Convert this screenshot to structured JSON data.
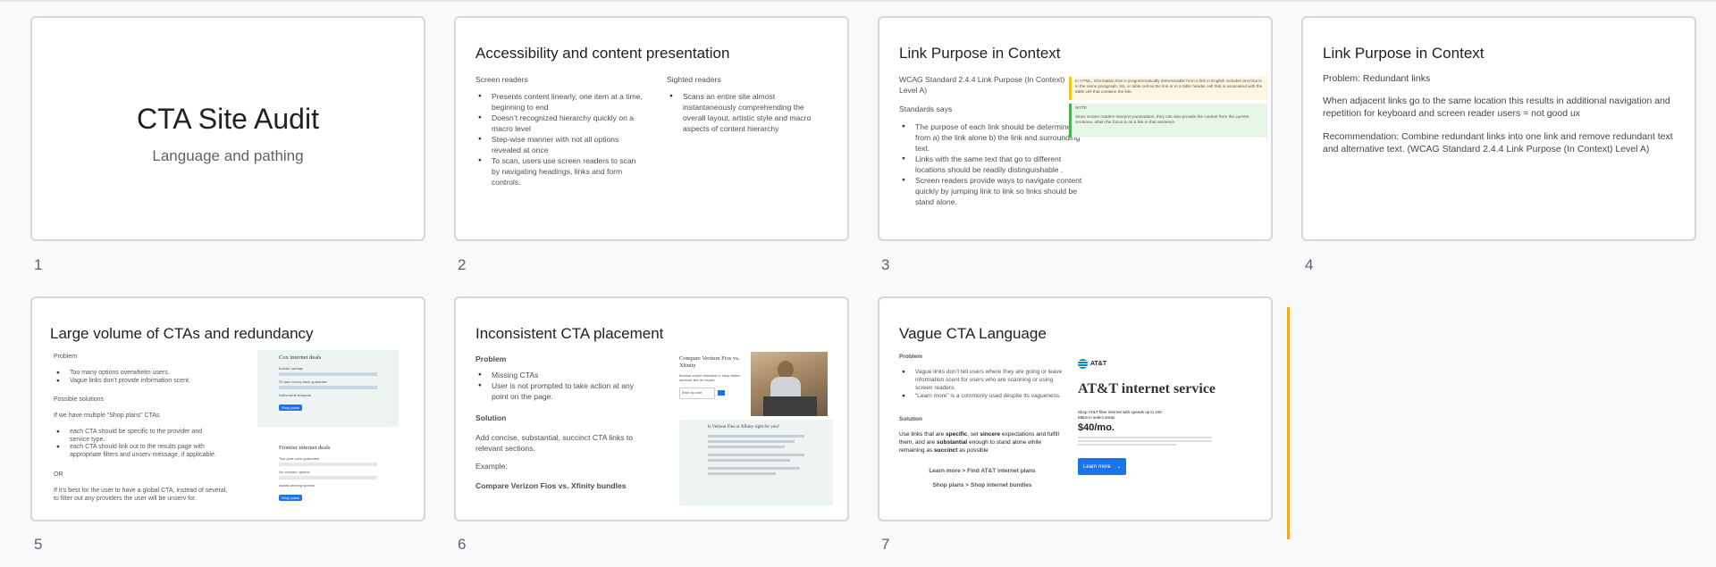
{
  "slides": [
    {
      "number": "1",
      "title": "CTA Site Audit",
      "subtitle": "Language and pathing"
    },
    {
      "number": "2",
      "title": "Accessibility and content presentation",
      "left_heading": "Screen readers",
      "left_bullets": [
        "Presents content linearly, one item at a time, beginning to end",
        "Doesn’t recognized hierarchy quickly on a macro level",
        "Step-wise manner with not all options revealed at once",
        "To scan, users use screen readers to scan by navigating headings, links and form controls."
      ],
      "right_heading": "Sighted readers",
      "right_bullets": [
        "Scans an entire site almost instantaneously comprehending the overall layout, artistic style and macro aspects of content hierarchy"
      ]
    },
    {
      "number": "3",
      "title": "Link Purpose in Context",
      "standard": "WCAG Standard 2.4.4 Link Purpose (In Context) Level A)",
      "standards_says": "Standards says",
      "bullets": [
        "The purpose of each link should  be determined from a) the link alone b) the link and surrounding text.",
        "Links with the same text that go to different locations should be readily distinguishable .",
        "Screen readers provide ways to navigate content quickly by jumping link to link so links should be stand alone."
      ],
      "quote_text": "In HTML, information that is programmatically determinable from a link in English includes text that is in the same paragraph, list, or table cell as the link or in a table header cell that is associated with the table cell that contains the link.",
      "note_label": "NOTE",
      "note_text": "Since screen readers interpret punctuation, they can also provide the context from the current sentence, when the focus is on a link in that sentence."
    },
    {
      "number": "4",
      "title": "Link Purpose in Context",
      "problem": "Problem: Redundant links",
      "para1": "When adjacent links go to the same location this results in additional navigation and repetition for keyboard and screen reader users = not good ux",
      "para2": "Recommendation: Combine redundant links into one link and remove redundant text and alternative text. (WCAG Standard 2.4.4 Link Purpose (In Context) Level A)"
    },
    {
      "number": "5",
      "title": "Large volume of CTAs and redundancy",
      "problem": "Problem",
      "bullets1": [
        "Too many options overwhelm users.",
        "Vague links don’t provide information scent."
      ],
      "possible": "Possible solutions",
      "if_multiple": "If we have multiple “Shop plans” CTAs",
      "bullets2": [
        "each CTA should be specific to the provider and service type.",
        "each CTA should link out to the results page with appropriate filters and unserv message, if applicable."
      ],
      "or": "OR",
      "last": "If it’s best for the user to have a global CTA, instead of several, to filter out any providers the user will be unserv for.",
      "panel1_title": "Cox internet deals",
      "panel1_lines": [
        "Bundle savings",
        "30-day money-back guarantee",
        "Nationwide hotspots"
      ],
      "panel1_button": "Shop plans",
      "panel2_title": "Frontier internet deals",
      "panel2_lines": [
        "Two-year price guarantee",
        "No contract options",
        "Award-winning speeds"
      ],
      "panel2_button": "Shop plans"
    },
    {
      "number": "6",
      "title": "Inconsistent CTA placement",
      "problem": "Problem",
      "bullets": [
        "Missing CTAs",
        "User is not prompted to take action at any point on the page."
      ],
      "solution": "Solution",
      "solution_text": "Add concise, substantial, succinct CTA links to relevant sections.",
      "example": "Example:",
      "example_text": "Compare Verizon Fios vs. Xfinity bundles",
      "card_title": "Compare Verizon Fios vs. Xfinity",
      "card_sub": "Browse expert research to shop better services like an expert",
      "card_input": "Enter zip code",
      "panel_title": "Is Verizon Fios or Xfinity right for you?"
    },
    {
      "number": "7",
      "title": "Vague CTA Language",
      "problem": "Problem",
      "bullets": [
        "Vague links don’t tell users where they are going or leave information scent for users who are scanning or using screen readers.",
        "“Learn more” is a commonly used despite its vagueness."
      ],
      "solution": "Solution",
      "sol_pre": "Use links that are ",
      "sol_b1": "specific",
      "sol_mid1": ", set ",
      "sol_b2": "sincere",
      "sol_mid2": " expectations and fulfill them, and are ",
      "sol_b3": "substantial",
      "sol_mid3": " enough to stand alone while remaining as ",
      "sol_b4": "succinct",
      "sol_end": " as possible",
      "link1": "Learn more > Find AT&T internet plans",
      "link2": "Shop plans > Shop internet bundles",
      "att_logo": "AT&T",
      "att_heading": "AT&T internet service",
      "att_sub": "Shop AT&T fiber internet with speeds up to 100 Mbps in select areas",
      "att_price": "$40/mo.",
      "att_button": "Learn more"
    }
  ]
}
